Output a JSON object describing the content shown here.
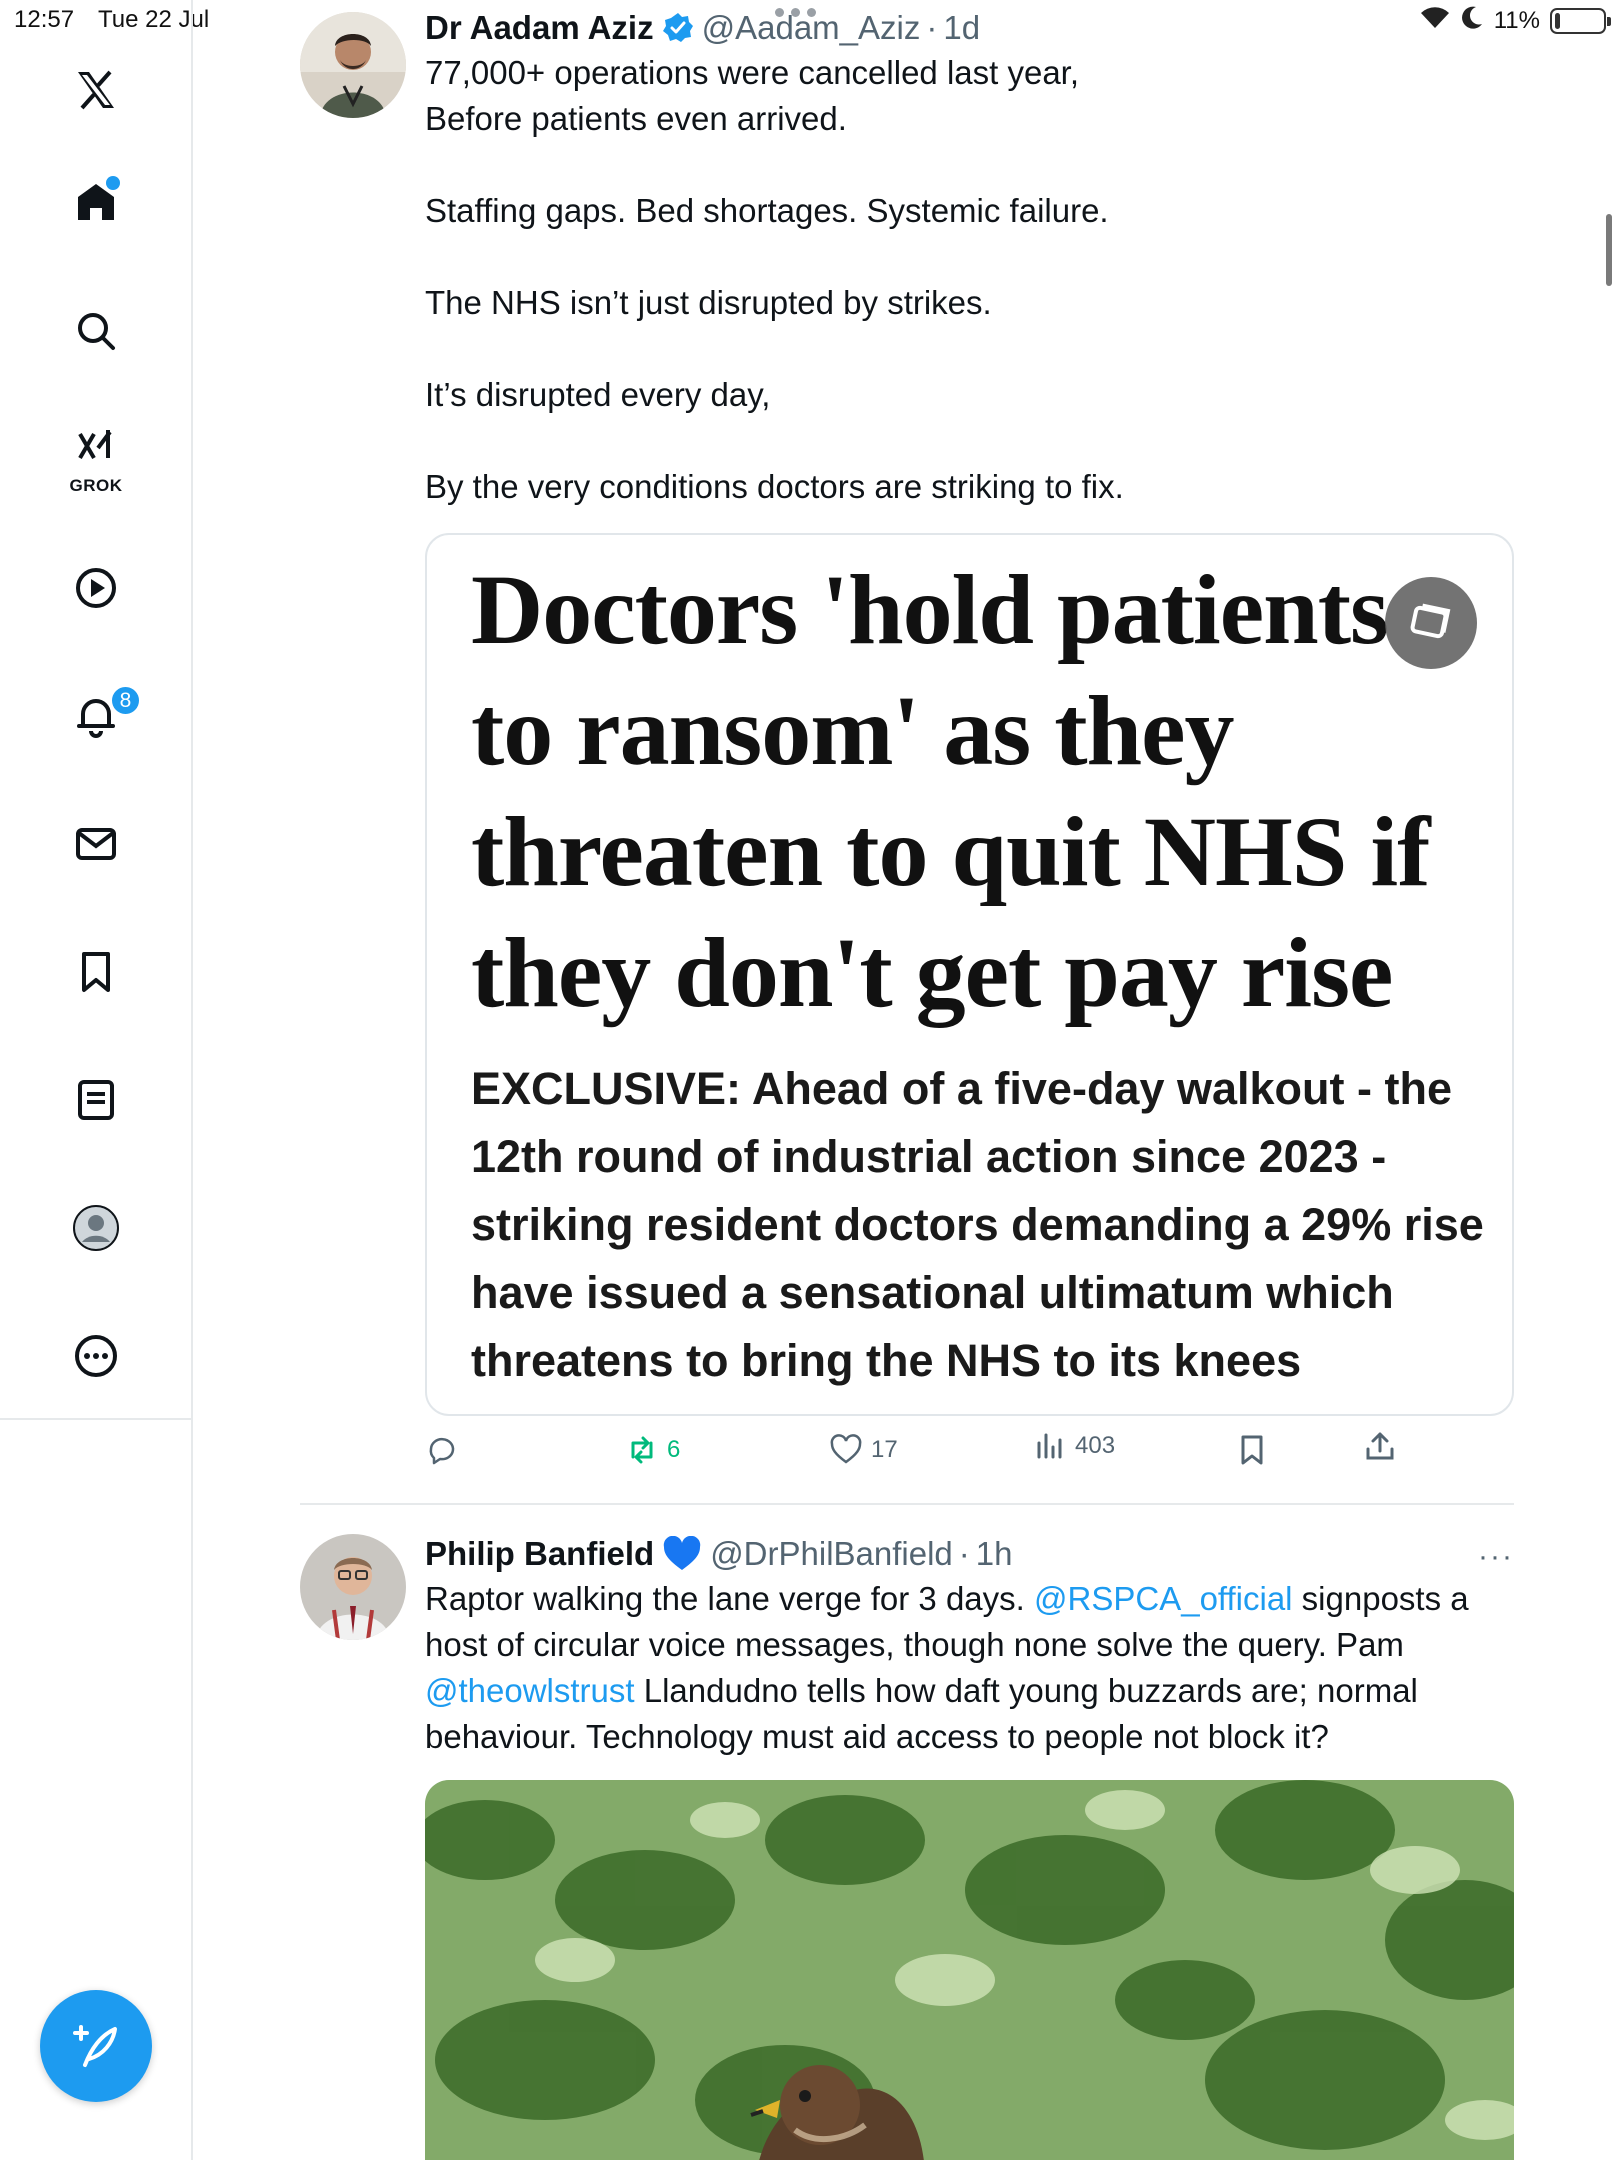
{
  "status_bar": {
    "time": "12:57",
    "date": "Tue 22 Jul",
    "battery": "11%",
    "battery_level": 0.11
  },
  "sidebar": {
    "logo": "x-logo-icon",
    "items": [
      {
        "name": "home",
        "icon": "home-icon",
        "active": true
      },
      {
        "name": "explore",
        "icon": "search-icon"
      },
      {
        "name": "grok",
        "icon": "grok-icon",
        "label": "GROK"
      },
      {
        "name": "videos",
        "icon": "play-icon"
      },
      {
        "name": "notifications",
        "icon": "bell-icon",
        "badge": "8"
      },
      {
        "name": "messages",
        "icon": "mail-icon"
      },
      {
        "name": "bookmarks",
        "icon": "bookmark-icon"
      },
      {
        "name": "lists",
        "icon": "list-icon"
      },
      {
        "name": "profile",
        "icon": "profile-icon"
      },
      {
        "name": "more",
        "icon": "more-icon"
      }
    ],
    "compose": "compose-icon"
  },
  "tweets": [
    {
      "name": "Dr Aadam Aziz",
      "verified": true,
      "handle": "@Aadam_Aziz",
      "time": "1d",
      "lines": [
        "77,000+ operations were cancelled last year,",
        "Before patients even arrived.",
        "",
        "Staffing gaps. Bed shortages. Systemic failure.",
        "",
        "The NHS isn’t just disrupted by strikes.",
        "",
        "It’s disrupted every day,",
        "",
        "By the very conditions doctors are striking to fix."
      ],
      "media": {
        "headline": "Doctors 'hold patients to ransom' as they threaten to quit NHS if they don't get pay rise",
        "subhead": "EXCLUSIVE: Ahead of a five-day walkout - the 12th round of industrial action since 2023 - striking resident doctors demanding a 29% rise have issued a sensational ultimatum which threatens to bring the NHS to its knees"
      },
      "stats": {
        "replies": "",
        "reposts": "6",
        "likes": "17",
        "views": "403"
      }
    },
    {
      "name": "Philip Banfield",
      "emoji": "blue-heart",
      "handle": "@DrPhilBanfield",
      "time": "1h",
      "text_parts": [
        "Raptor walking the lane verge for 3 days. ",
        "@RSPCA_official",
        " signposts a host of circular voice messages, though none solve the query. Pam ",
        "@theowlstrust",
        " Llandudno tells how daft young buzzards are; normal behaviour. Technology must aid access to people not block it?"
      ]
    }
  ]
}
